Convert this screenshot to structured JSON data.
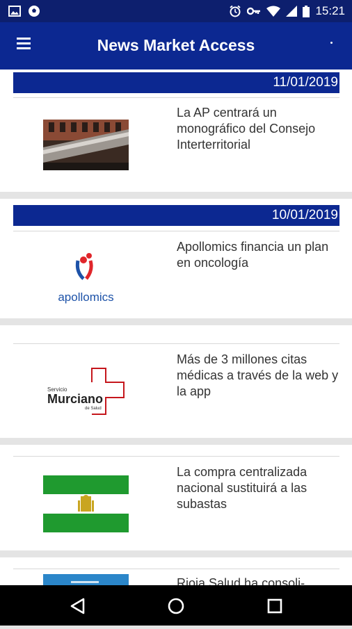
{
  "status_bar": {
    "time": "15:21"
  },
  "app_bar": {
    "title": "News Market Access"
  },
  "news": [
    {
      "date": "11/01/2019",
      "headline": "La AP centrará un monográfico del Consejo Interterritorial",
      "thumb": "ministry-building-image"
    },
    {
      "date": "10/01/2019",
      "headline": "Apollomics financia un plan en oncología",
      "thumb": "apollomics-logo",
      "logo_text": "apollomics"
    },
    {
      "date": "",
      "headline": "Más de 3 millones citas médicas a través de la web y la app",
      "thumb": "servicio-murciano-logo",
      "logo_small": "Servicio",
      "logo_big": "Murciano",
      "logo_sub": "de Salud"
    },
    {
      "date": "",
      "headline": "La compra centralizada nacional sustituirá a las subastas",
      "thumb": "andalusia-flag-image"
    },
    {
      "date": "",
      "headline": "Rioja Salud ha consoli-",
      "thumb": "rioja-salud-image"
    }
  ],
  "colors": {
    "primary": "#0c2891",
    "status_bar": "#0d1f6e",
    "background": "#e4e4e4"
  },
  "icons": [
    "image-icon",
    "soccer-ball-icon",
    "alarm-icon",
    "key-icon",
    "wifi-icon",
    "signal-icon",
    "battery-icon",
    "menu-icon",
    "back-icon",
    "home-icon",
    "recents-icon"
  ]
}
